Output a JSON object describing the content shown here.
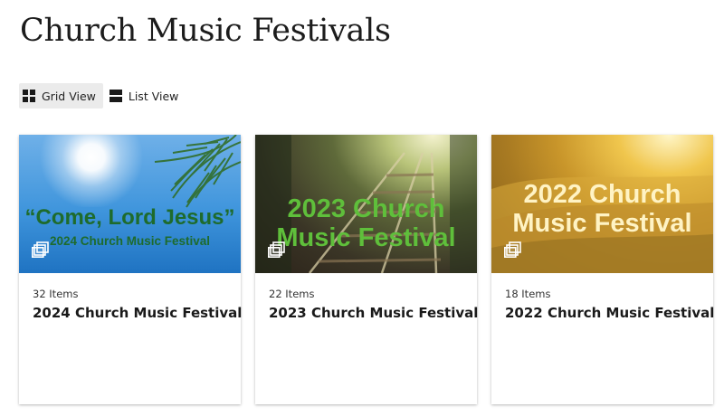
{
  "page": {
    "title": "Church Music Festivals"
  },
  "view_toggle": {
    "grid_label": "Grid View",
    "list_label": "List View",
    "active": "grid"
  },
  "colors": {
    "thumb1_text": "#1e6b2c",
    "thumb2_text": "#5fbf3b",
    "thumb3_text": "#fff3c4"
  },
  "cards": [
    {
      "count": "32 Items",
      "title": "2024 Church Music Festival",
      "thumb_line1": "“Come, Lord Jesus”",
      "thumb_line2": "2024 Church Music Festival",
      "icon": "album-stack-icon"
    },
    {
      "count": "22 Items",
      "title": "2023 Church Music Festival",
      "thumb_line1": "2023 Church",
      "thumb_line2": "Music Festival",
      "icon": "album-stack-icon"
    },
    {
      "count": "18 Items",
      "title": "2022 Church Music Festival",
      "thumb_line1": "2022 Church",
      "thumb_line2": "Music Festival",
      "icon": "album-stack-icon"
    }
  ]
}
